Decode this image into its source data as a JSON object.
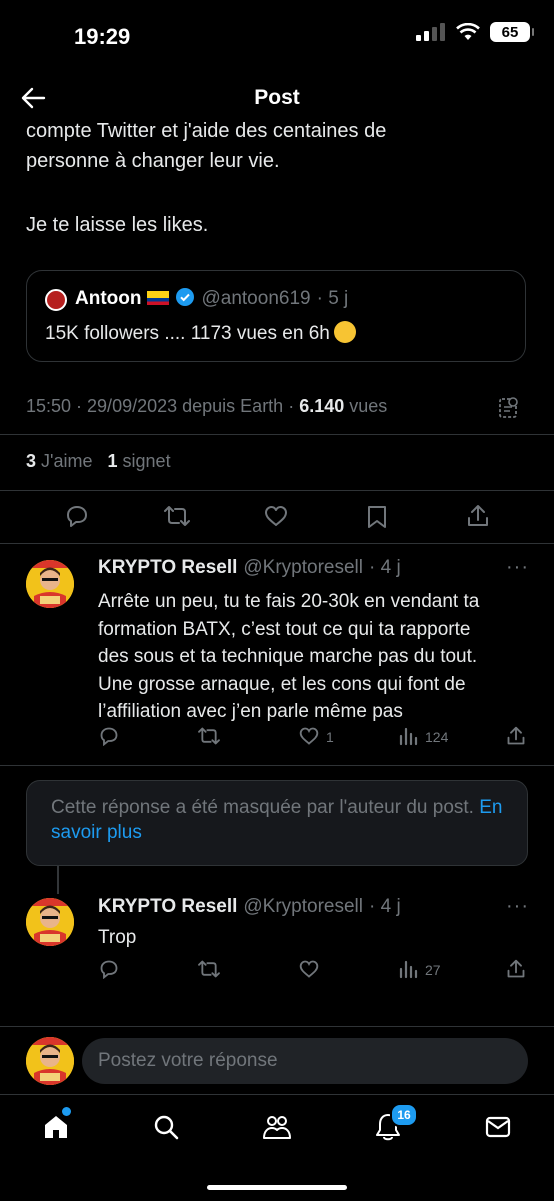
{
  "status_bar": {
    "time": "19:29",
    "battery": "65"
  },
  "header": {
    "title": "Post"
  },
  "tweet": {
    "text_line1": "compte Twitter et j'aide des centaines de",
    "text_line2": "personne à changer leur vie.",
    "text_line3": "Je te laisse les likes.",
    "quote": {
      "name": "Antoon",
      "handle": "@antoon619",
      "time": "· 5 j",
      "text": "15K followers .... 1173 vues en 6h"
    },
    "meta_time": "15:50 · 29/09/2023 depuis Earth ·",
    "meta_views_count": "6.140",
    "meta_views_label": "vues",
    "likes_count": "3",
    "likes_label": "J'aime",
    "bookmarks_count": "1",
    "bookmarks_label": "signet"
  },
  "replies": [
    {
      "name": "KRYPTO Resell",
      "handle": "@Kryptoresell",
      "time": "· 4 j",
      "lines": [
        "Arrête un peu, tu te fais 20-30k en vendant ta",
        "formation BATX, c’est tout ce qui ta rapporte",
        "des sous et ta technique marche pas du tout.",
        "Une grosse arnaque, et les cons qui font de",
        "l’affiliation avec j’en parle même pas"
      ],
      "likes": "1",
      "views": "124"
    },
    {
      "name": "KRYPTO Resell",
      "handle": "@Kryptoresell",
      "time": "· 4 j",
      "lines": [
        "Trop"
      ],
      "likes": "",
      "views": "27"
    }
  ],
  "masked_reply": {
    "text": "Cette réponse a été masquée par l'auteur du post.",
    "link": "En savoir plus"
  },
  "composer": {
    "placeholder": "Postez votre réponse"
  },
  "tab_bar": {
    "notifications_badge": "16"
  },
  "colors": {
    "accent": "#1d9bf0",
    "background": "#000000",
    "muted": "#71767b",
    "text": "#e7e9ea"
  }
}
